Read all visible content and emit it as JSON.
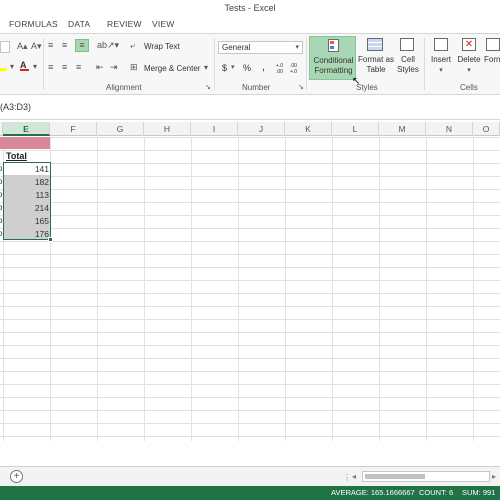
{
  "window": {
    "title": "Tests - Excel"
  },
  "tabs": [
    "FORMULAS",
    "DATA",
    "REVIEW",
    "VIEW"
  ],
  "ribbon": {
    "wrap_text": "Wrap Text",
    "merge_center": "Merge & Center",
    "number_format": "General",
    "currency": "$",
    "percent": "%",
    "comma": ",",
    "increase_decimal": "+.0 .00",
    "decrease_decimal": ".00 +.0",
    "conditional_formatting": [
      "Conditional",
      "Formatting"
    ],
    "format_as_table": [
      "Format as",
      "Table"
    ],
    "cell_styles": [
      "Cell",
      "Styles"
    ],
    "insert": "Insert",
    "delete": "Delete",
    "format": "Form",
    "groups": {
      "alignment": "Alignment",
      "number": "Number",
      "styles": "Styles",
      "cells": "Cells"
    },
    "active_button_color": "#a9d7b3"
  },
  "formula_bar": {
    "text": "(A3:D3)"
  },
  "columns": [
    "E",
    "F",
    "G",
    "H",
    "I",
    "J",
    "K",
    "L",
    "M",
    "N",
    "O"
  ],
  "sheet": {
    "header_label": "Total",
    "header_fill_color": "#d9879b",
    "selection_fill_color": "#cfcfcf",
    "selection_border_color": "#217346",
    "values": [
      "141",
      "182",
      "113",
      "214",
      "165",
      "176"
    ],
    "row_edge_markers": [
      "o",
      "o",
      "o",
      "o",
      "o",
      "o"
    ]
  },
  "statusbar": {
    "average": "AVERAGE: 165.1666667",
    "count": "COUNT: 6",
    "sum": "SUM: 991",
    "background": "#217346"
  },
  "icons": {
    "add_sheet": "plus-circle-icon",
    "font_color": "font-color-icon",
    "fill_color": "fill-color-icon"
  }
}
